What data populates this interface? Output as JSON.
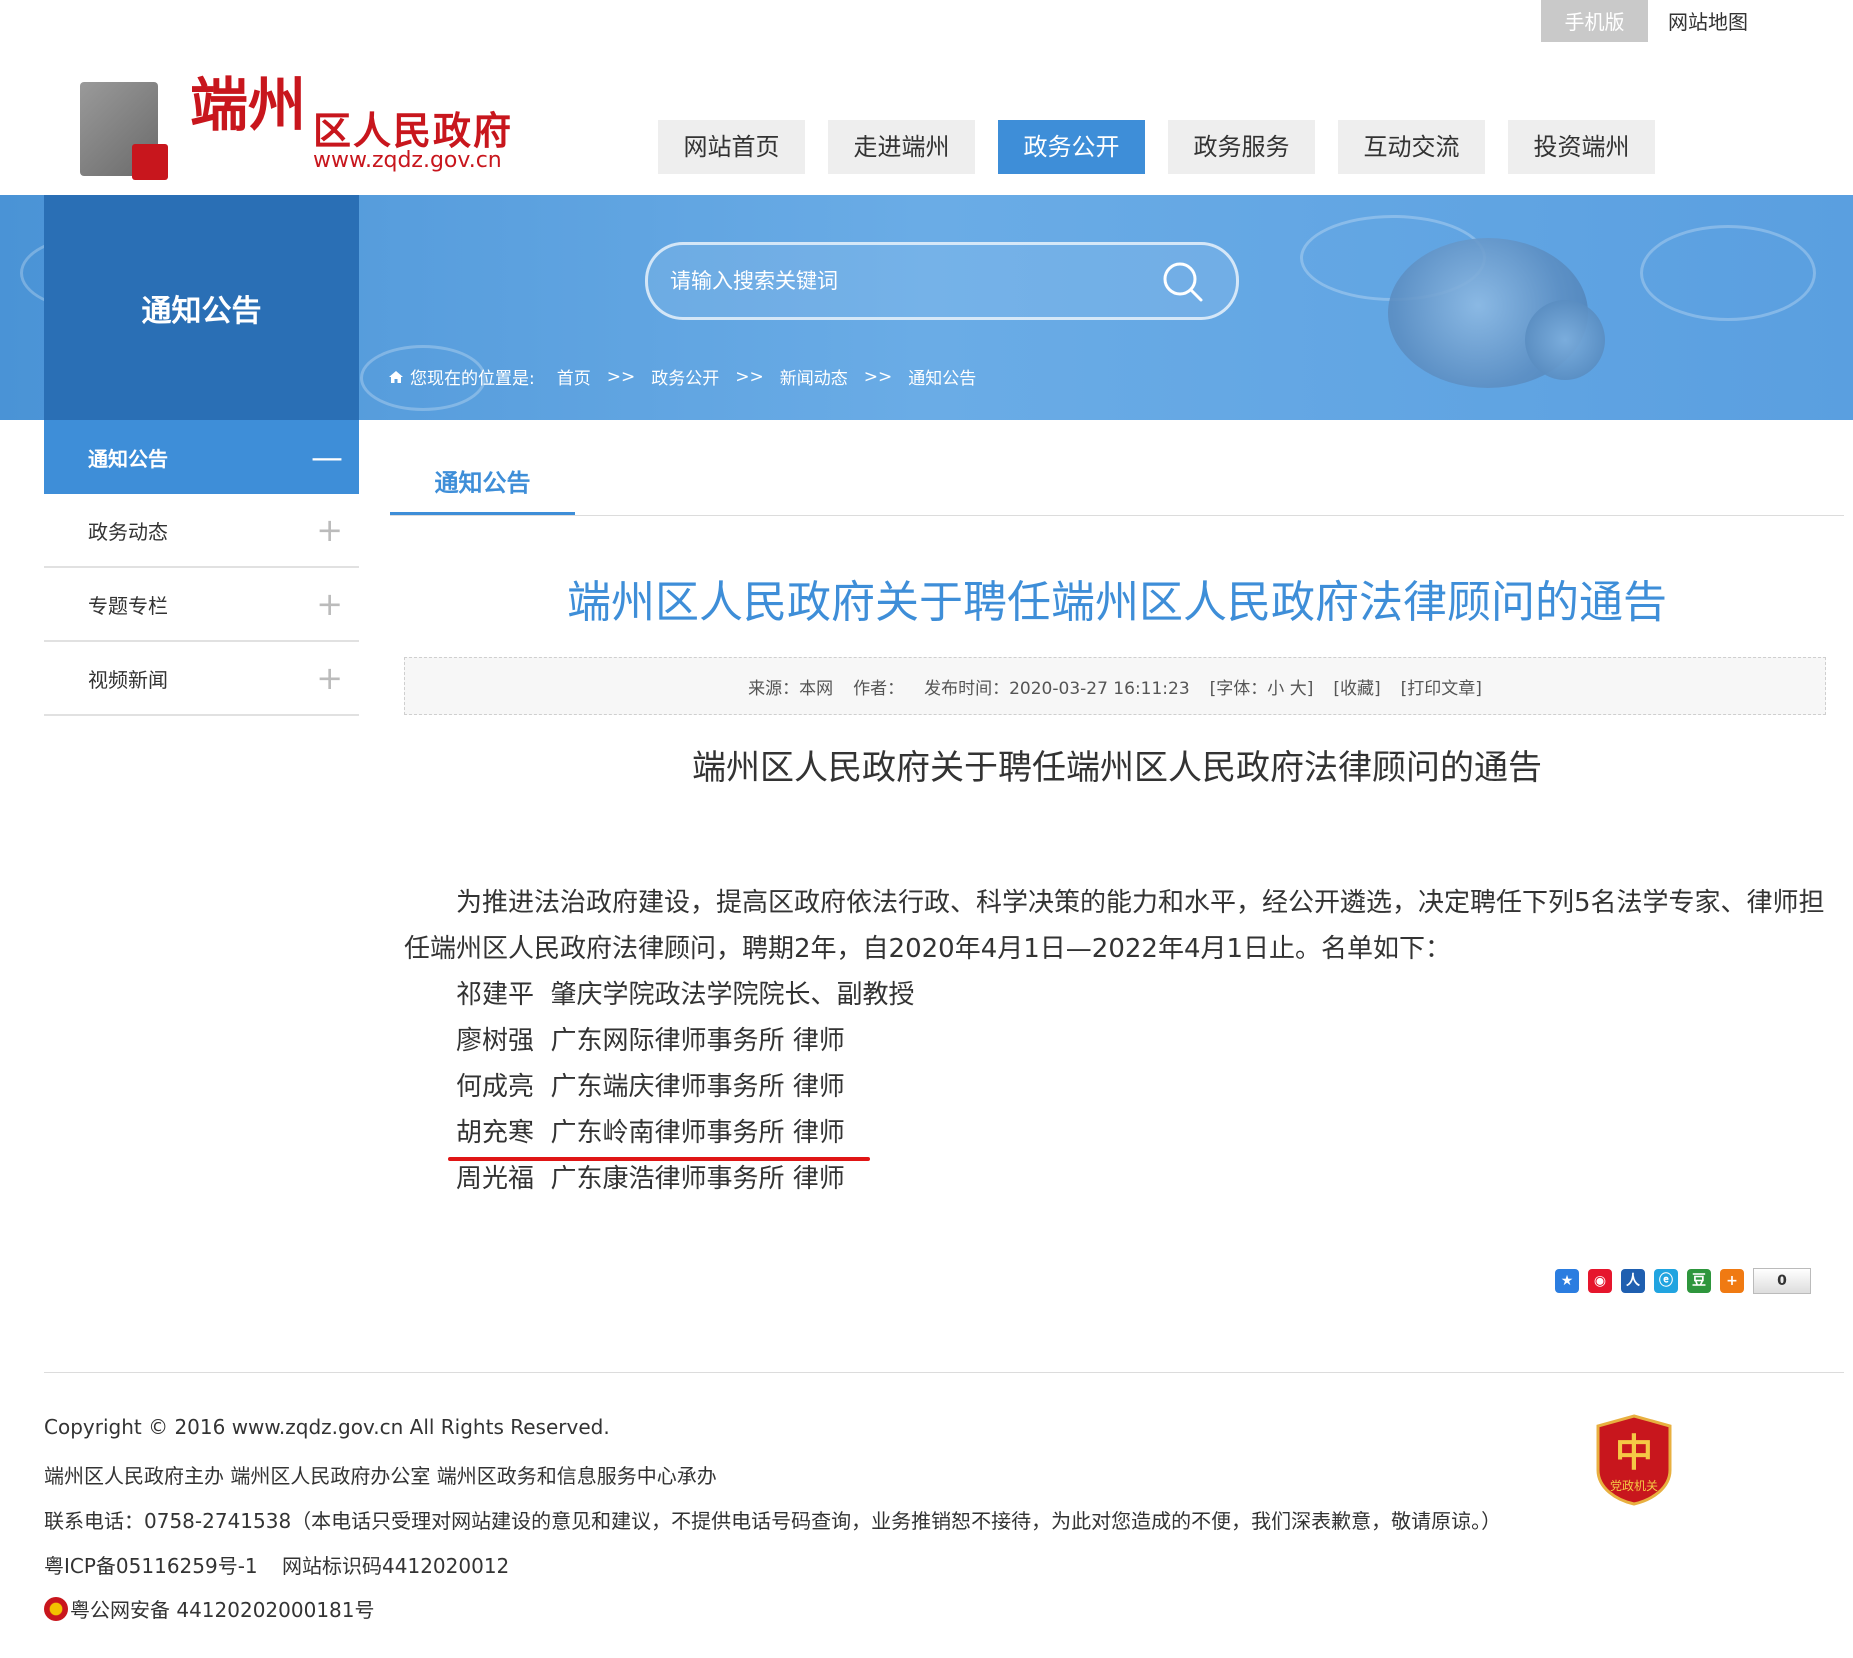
{
  "utility": {
    "mobile": "手机版",
    "sitemap": "网站地图"
  },
  "logo": {
    "calligraphy": "端州",
    "title": "区人民政府",
    "url": "www.zqdz.gov.cn"
  },
  "nav": [
    "网站首页",
    "走进端州",
    "政务公开",
    "政务服务",
    "互动交流",
    "投资端州"
  ],
  "nav_active_index": 2,
  "banner": {
    "side_title": "通知公告"
  },
  "search": {
    "placeholder": "请输入搜索关键词"
  },
  "breadcrumb": {
    "prefix": "您现在的位置是:",
    "items": [
      "首页",
      "政务公开",
      "新闻动态",
      "通知公告"
    ],
    "separator": ">>"
  },
  "sidebar": [
    {
      "label": "通知公告",
      "toggle": "—",
      "active": true
    },
    {
      "label": "政务动态",
      "toggle": "+",
      "active": false
    },
    {
      "label": "专题专栏",
      "toggle": "+",
      "active": false
    },
    {
      "label": "视频新闻",
      "toggle": "+",
      "active": false
    }
  ],
  "main_tab": "通知公告",
  "article": {
    "title": "端州区人民政府关于聘任端州区人民政府法律顾问的通告",
    "meta": {
      "source": "来源：本网",
      "author": "作者：",
      "published": "发布时间：2020-03-27 16:11:23",
      "font": "[字体：小 大]",
      "favorite": "[收藏]",
      "print": "[打印文章]"
    },
    "subtitle": "端州区人民政府关于聘任端州区人民政府法律顾问的通告",
    "intro": "为推进法治政府建设，提高区政府依法行政、科学决策的能力和水平，经公开遴选，决定聘任下列5名法学专家、律师担任端州区人民政府法律顾问，聘期2年，自2020年4月1日—2022年4月1日止。名单如下：",
    "list": [
      "祁建平  肇庆学院政法学院院长、副教授",
      "廖树强  广东网际律师事务所 律师",
      "何成亮  广东端庆律师事务所 律师",
      "胡充寒  广东岭南律师事务所 律师",
      "周光福  广东康浩律师事务所 律师"
    ]
  },
  "share": {
    "icons": [
      "qzone",
      "weibo",
      "renren",
      "tqq",
      "douban",
      "more"
    ],
    "count": "0"
  },
  "footer": {
    "copyright": "Copyright © 2016 www.zqdz.gov.cn All Rights Reserved.",
    "host": "端州区人民政府主办 端州区人民政府办公室 端州区政务和信息服务中心承办",
    "contact": "联系电话：0758-2741538（本电话只受理对网站建设的意见和建议，不提供电话号码查询，业务推销恕不接待，为此对您造成的不便，我们深表歉意，敬请原谅。）",
    "icp": "粤ICP备05116259号-1",
    "site_id": "网站标识码4412020012",
    "police": "粤公网安备 44120202000181号",
    "badge_text": "党政机关"
  },
  "colors": {
    "accent": "#3e8ed8",
    "sidebar_dark": "#2a6fb5",
    "brand_red": "#c8161d",
    "highlight_underline": "#e01515"
  }
}
